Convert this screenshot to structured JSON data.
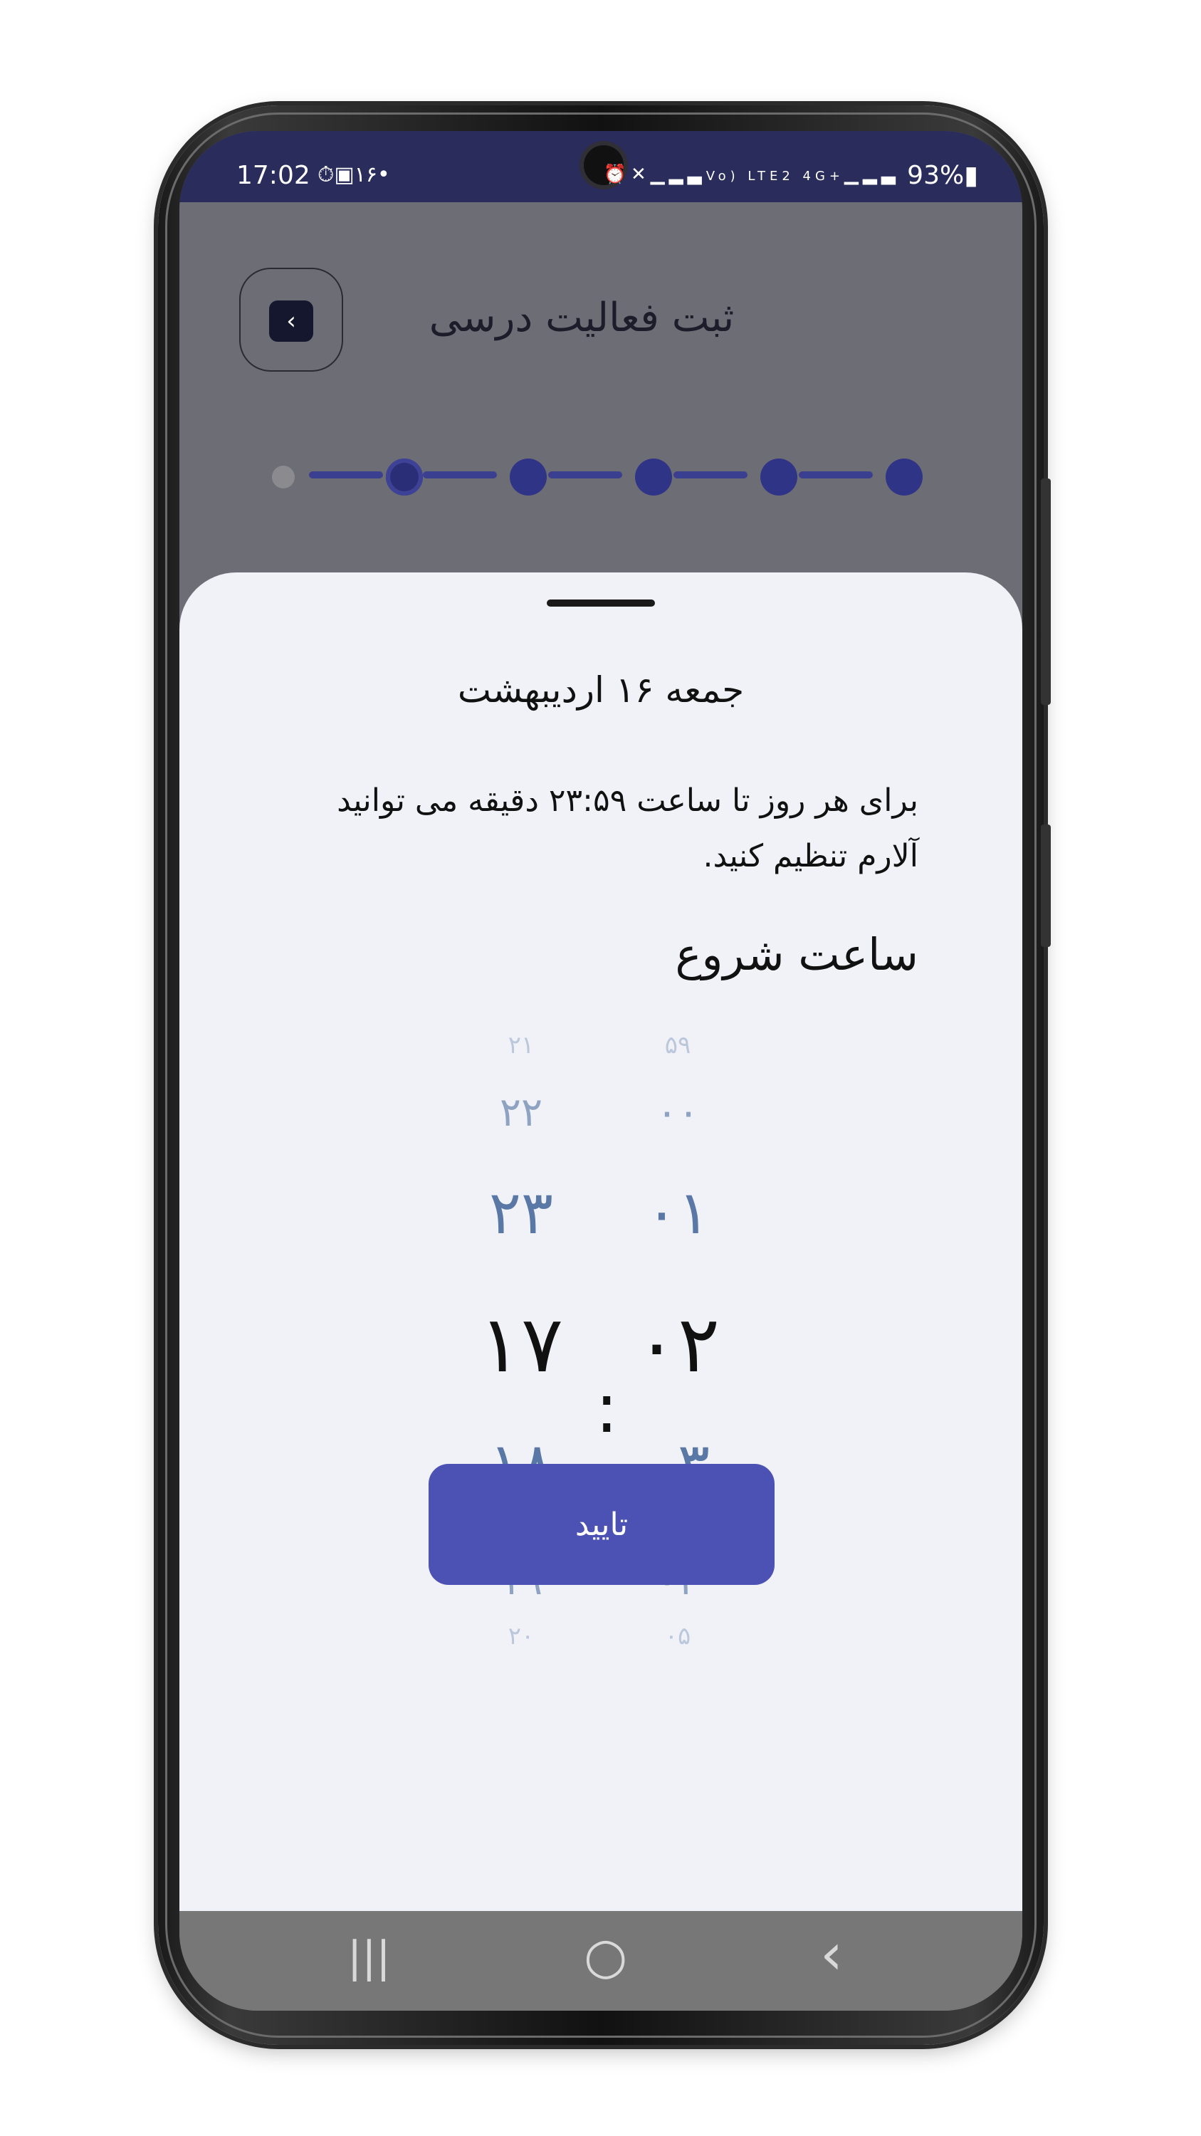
{
  "status_bar": {
    "time": "17:02",
    "left_icons": [
      "timer-icon",
      "gallery-icon",
      "notification-badge-icon",
      "dot-icon"
    ],
    "badge_text": "۱۶",
    "battery": "93%",
    "network_labels": "Vo) LTE2 4G+",
    "right_icons": [
      "alarm-icon",
      "mute-icon",
      "signal-icon",
      "signal-icon",
      "battery-icon"
    ]
  },
  "header": {
    "title": "ثبت فعالیت درسی",
    "back_icon": "chevron-left-icon"
  },
  "stepper": {
    "total_steps": 6,
    "current_step": 1
  },
  "sheet": {
    "date_title": "جمعه ۱۶ اردیبهشت",
    "description_line1": "برای هر روز تا ساعت ۲۳:۵۹ دقیقه می توانید",
    "description_line2": "آلارم تنظیم کنید.",
    "section_title": "ساعت شروع"
  },
  "time_picker": {
    "colon": ":",
    "hours": [
      "۲۱",
      "۲۲",
      "۲۳",
      "۱۷",
      "۱۸",
      "۱۹",
      "۲۰"
    ],
    "minutes": [
      "۵۹",
      "۰۰",
      "۰۱",
      "۰۲",
      "۰۳",
      "۰۴",
      "۰۵"
    ],
    "selected_hour": "۱۷",
    "selected_minute": "۰۲"
  },
  "confirm_button": "تایید",
  "nav_bar": {
    "recents_icon": "|||",
    "home_icon": "○",
    "back_icon": "‹"
  },
  "colors": {
    "status_bar": "#2a2c5c",
    "accent": "#4b52b3",
    "stepper": "#2f3486",
    "sheet_bg": "#f1f2f8",
    "picker_digits": "#5a78a6"
  }
}
